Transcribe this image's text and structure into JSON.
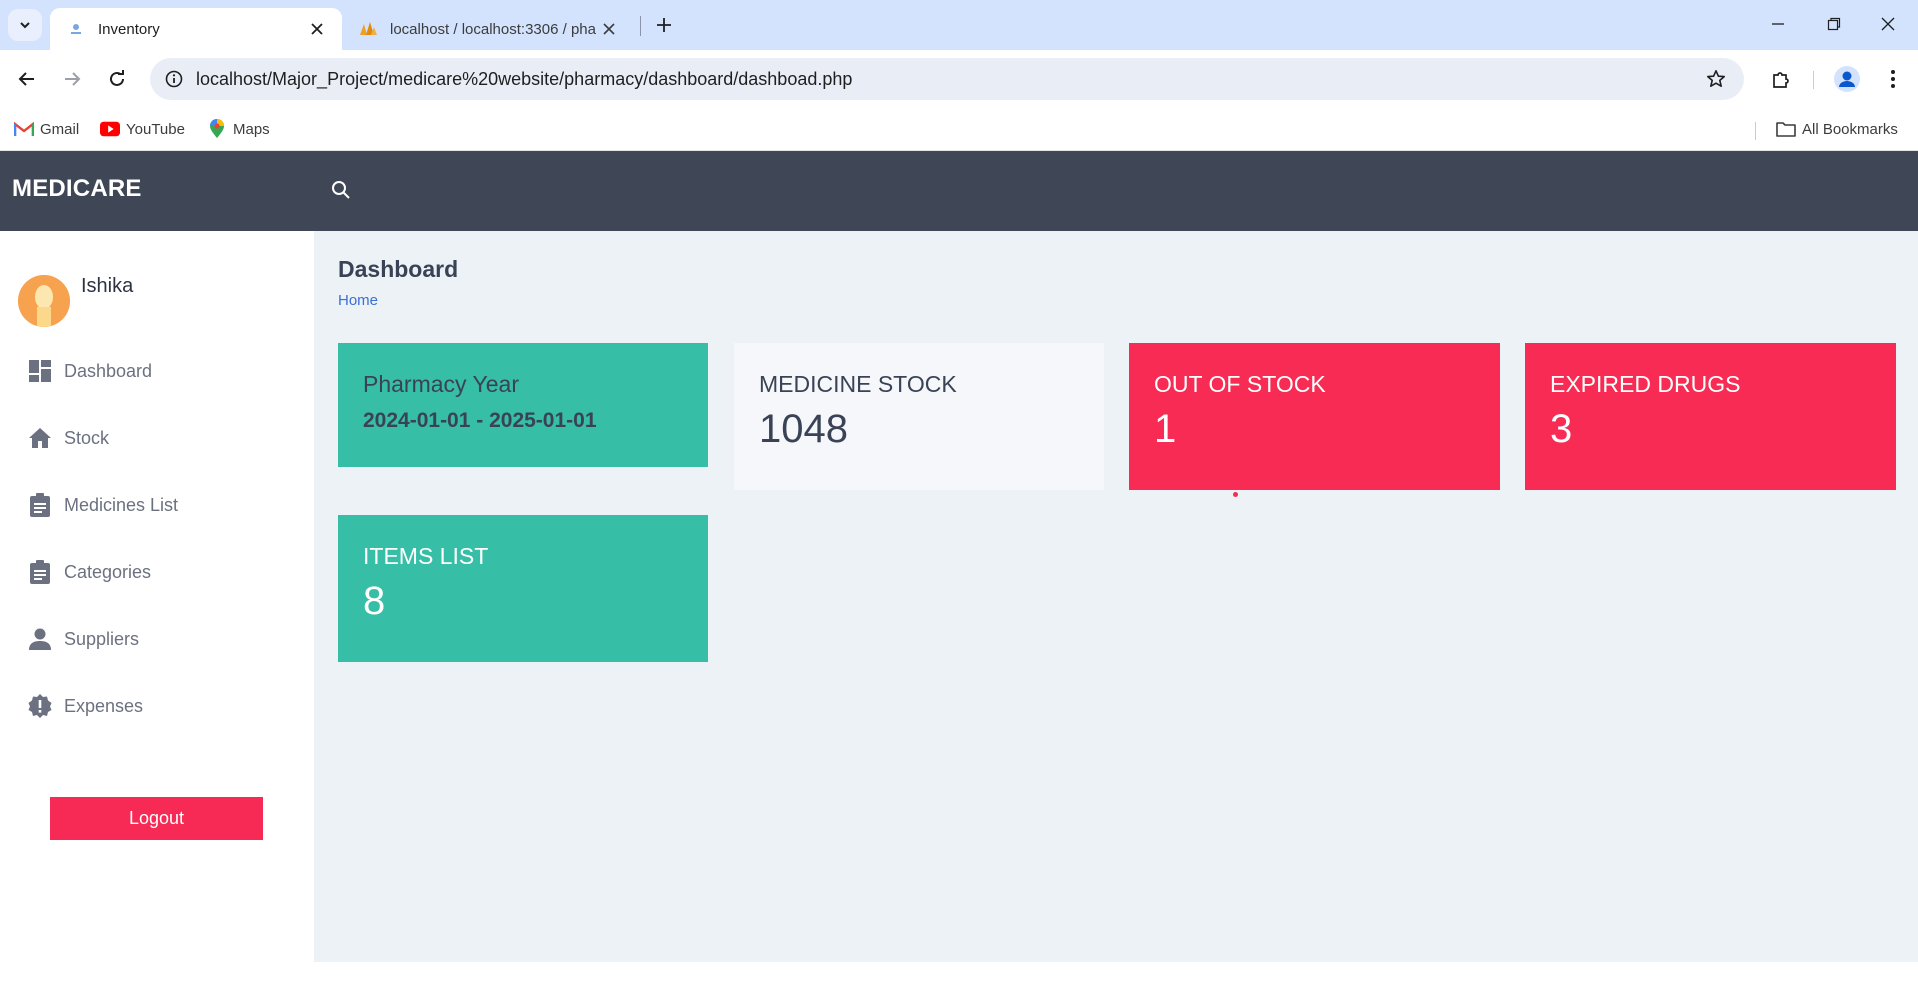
{
  "browser": {
    "tabs": [
      {
        "title": "Inventory",
        "active": true
      },
      {
        "title": "localhost / localhost:3306 / pha",
        "active": false
      }
    ],
    "url": "localhost/Major_Project/medicare%20website/pharmacy/dashboard/dashboad.php",
    "bookmarks": [
      {
        "label": "Gmail",
        "icon": "gmail-icon"
      },
      {
        "label": "YouTube",
        "icon": "youtube-icon"
      },
      {
        "label": "Maps",
        "icon": "maps-icon"
      }
    ],
    "all_bookmarks_label": "All Bookmarks"
  },
  "app": {
    "brand": "MEDICARE",
    "user": {
      "name": "Ishika"
    },
    "nav": [
      {
        "label": "Dashboard",
        "icon": "dashboard-icon"
      },
      {
        "label": "Stock",
        "icon": "home-icon"
      },
      {
        "label": "Medicines List",
        "icon": "clipboard-icon"
      },
      {
        "label": "Categories",
        "icon": "clipboard-icon"
      },
      {
        "label": "Suppliers",
        "icon": "person-icon"
      },
      {
        "label": "Expenses",
        "icon": "alert-badge-icon"
      }
    ],
    "logout_label": "Logout"
  },
  "page": {
    "title": "Dashboard",
    "breadcrumb": "Home"
  },
  "cards": {
    "pharmacy_year": {
      "title": "Pharmacy Year",
      "value": "2024-01-01 - 2025-01-01"
    },
    "medicine_stock": {
      "title": "MEDICINE STOCK",
      "value": "1048"
    },
    "out_of_stock": {
      "title": "OUT OF STOCK",
      "value": "1"
    },
    "expired_drugs": {
      "title": "EXPIRED DRUGS",
      "value": "3"
    },
    "items_list": {
      "title": "ITEMS LIST",
      "value": "8"
    }
  },
  "colors": {
    "header_bg": "#3f4656",
    "teal": "#36bea7",
    "red": "#f72b53",
    "main_bg": "#ecf2f6"
  }
}
